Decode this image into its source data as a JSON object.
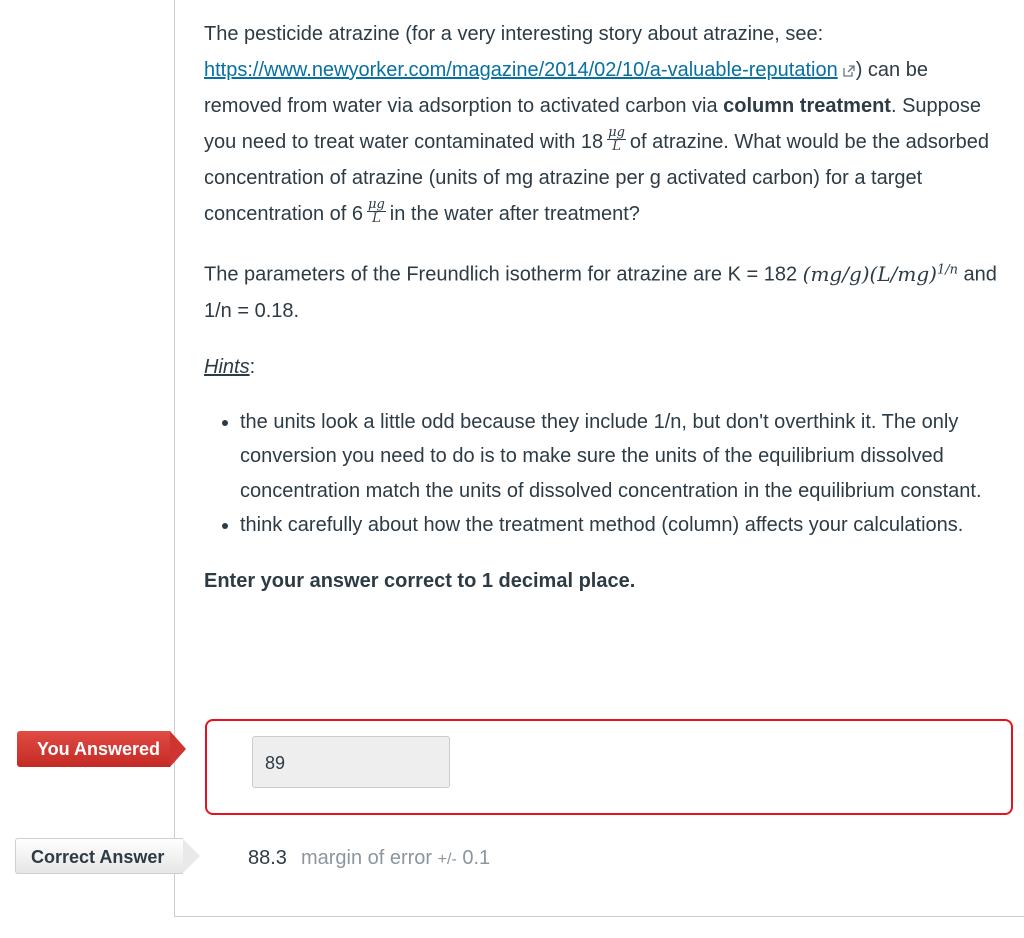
{
  "question": {
    "p1_a": "The pesticide atrazine (for a very interesting story about atrazine, see: ",
    "link_text": "https://www.newyorker.com/magazine/2014/02/10/a-valuable-reputation",
    "link_icon": "external-link-icon",
    "p1_b": ")",
    "p1_c": " can be removed from water via adsorption to activated carbon via ",
    "p1_bold": "column treatment",
    "p1_d": ". Suppose you need to treat water contaminated with 18",
    "unit_num": "μg",
    "unit_den": "L",
    "p1_e": "of atrazine. What would be the adsorbed concentration of atrazine (units of mg atrazine per g activated carbon) for a target concentration of 6",
    "p1_f": "in the water after treatment?",
    "p2_a": "The parameters of the Freundlich isotherm for atrazine are K = 182 ",
    "p2_math": "(mg/g)(L/mg)",
    "p2_math_sup": "1/n",
    "p2_b": " and 1/n = 0.18.",
    "hints_label": "Hints",
    "hints_colon": ":",
    "hints": [
      "the units look a little odd because they include 1/n, but don't overthink it. The only conversion you need to do is to make sure the units of the equilibrium dissolved concentration match the units of dissolved concentration in the equilibrium constant.",
      "think carefully about how the treatment method (column) affects your calculations."
    ],
    "instruction": "Enter your answer correct to 1 decimal place."
  },
  "you_answered": {
    "label": "You Answered",
    "value": "89",
    "status_color": "#e3151c"
  },
  "correct_answer": {
    "label": "Correct Answer",
    "value": "88.3",
    "margin_label": "margin of error",
    "margin_pm": "+/-",
    "margin_value": "0.1"
  }
}
